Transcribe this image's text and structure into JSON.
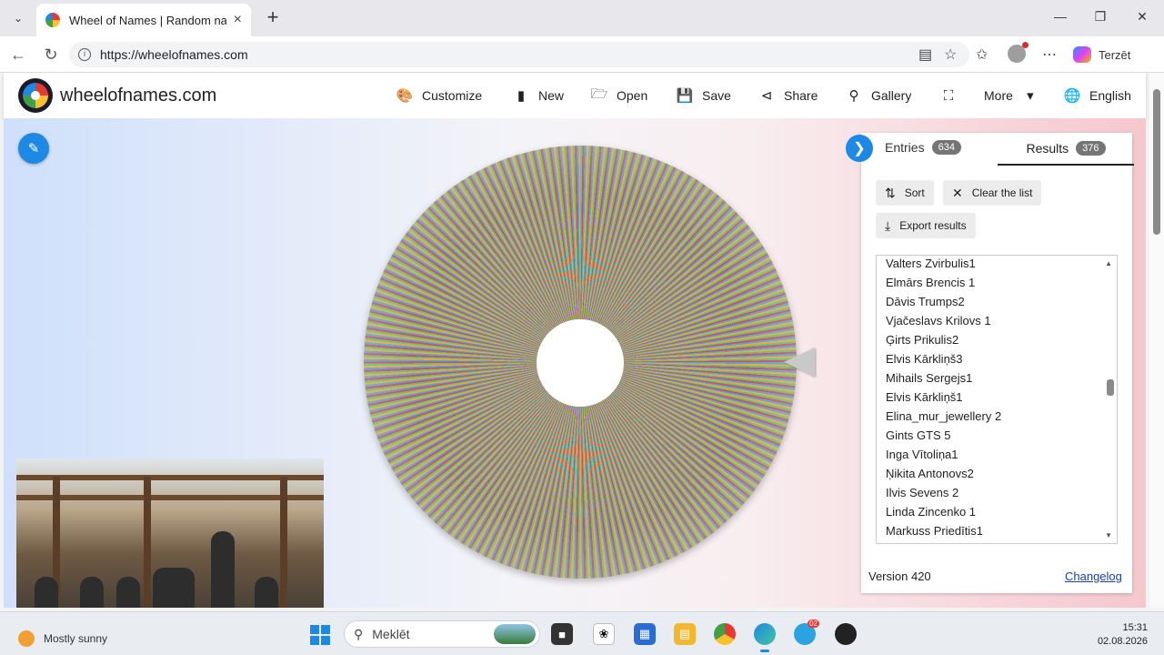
{
  "browser": {
    "tab_title": "Wheel of Names | Random name p",
    "url": "https://wheelofnames.com",
    "profile_label": "Terzēt"
  },
  "header": {
    "site_name": "wheelofnames.com",
    "menu": {
      "customize": "Customize",
      "new": "New",
      "open": "Open",
      "save": "Save",
      "share": "Share",
      "gallery": "Gallery",
      "more": "More",
      "language": "English"
    }
  },
  "panel": {
    "tabs": {
      "entries_label": "Entries",
      "entries_count": "634",
      "results_label": "Results",
      "results_count": "376"
    },
    "buttons": {
      "sort": "Sort",
      "clear": "Clear the list",
      "export": "Export results"
    },
    "results": [
      "Valters Zvirbulis1",
      "Elmārs Brencis 1",
      "Dāvis Trumps2",
      "Vjačeslavs Krilovs 1",
      "Ģirts Prikulis2",
      "Elvis Kārkliņš3",
      "Mihails Sergejs1",
      "Elvis Kārkliņš1",
      "Elina_mur_jewellery 2",
      "Gints GTS 5",
      "Inga Vītoliņa1",
      "Ņikita Antonovs2",
      "Ilvis Sevens 2",
      "Linda Zincenko 1",
      "Markuss Priedītis1"
    ],
    "version": "Version 420",
    "changelog": "Changelog"
  },
  "taskbar": {
    "weather": "Mostly sunny",
    "search_placeholder": "Meklēt",
    "time": "15:31",
    "date": "02.08.2026",
    "telegram_badge": "02"
  },
  "colors": {
    "accent": "#1e88e5",
    "wheel_green": "#7bb86a",
    "wheel_red": "#c0546c",
    "wheel_blue": "#6d9bd0",
    "wheel_yellow": "#d4b24b"
  }
}
